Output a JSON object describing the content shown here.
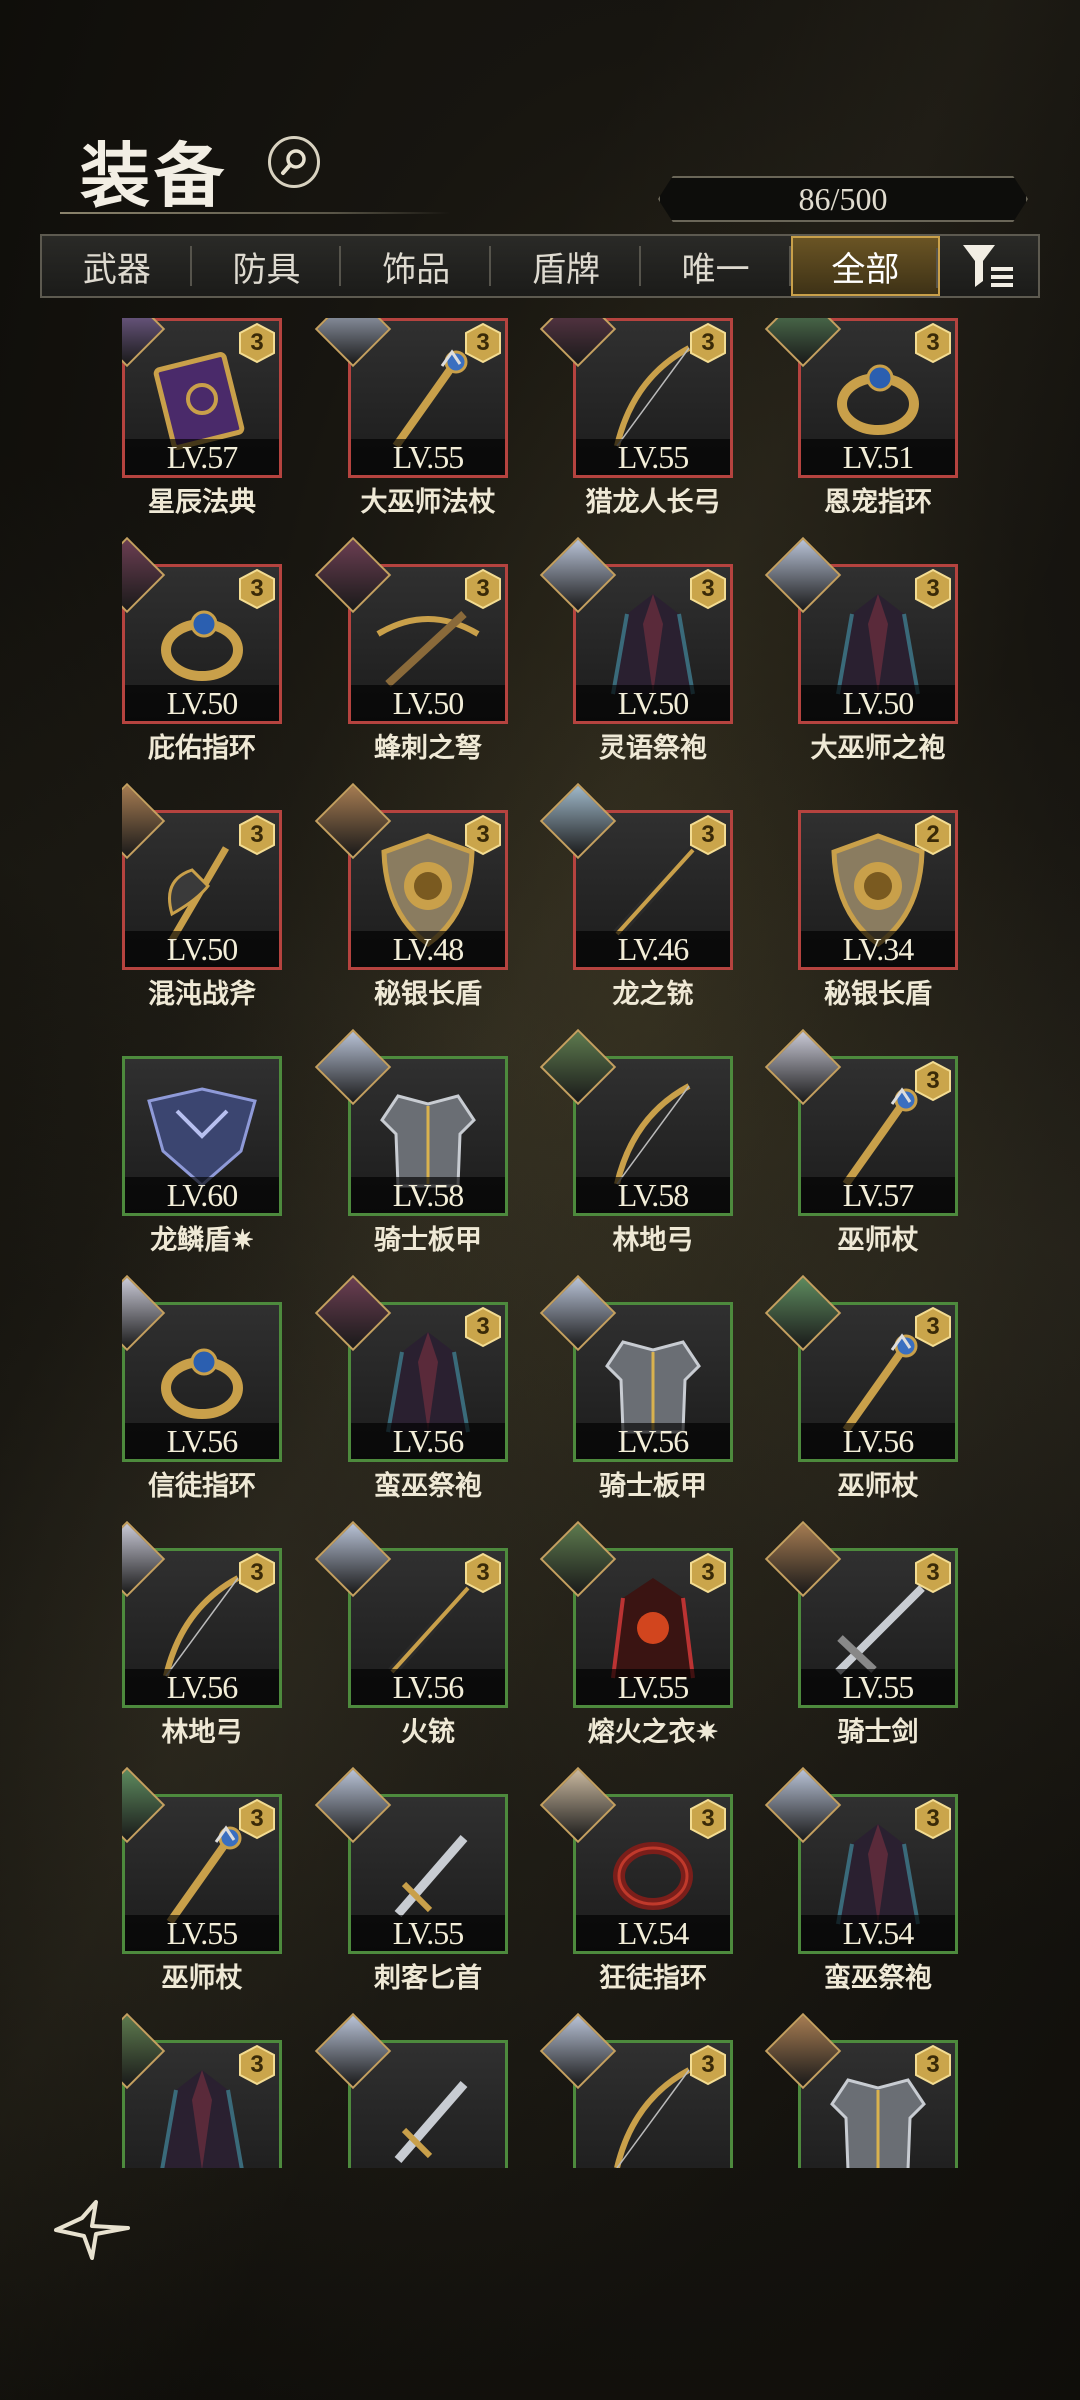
{
  "header": {
    "title": "装备"
  },
  "counter": {
    "text": "86/500"
  },
  "tabs": [
    {
      "label": "武器",
      "active": false
    },
    {
      "label": "防具",
      "active": false
    },
    {
      "label": "饰品",
      "active": false
    },
    {
      "label": "盾牌",
      "active": false
    },
    {
      "label": "唯一",
      "active": false
    },
    {
      "label": "全部",
      "active": true
    }
  ],
  "colors": {
    "red_border": "#b5433f",
    "green_border": "#4d8a3d",
    "gold": "#c9a04a"
  },
  "items": [
    {
      "name": "星辰法典",
      "level": "LV.57",
      "rank": "3",
      "rarity": "red",
      "icon": "book-icon",
      "portrait": "#8a6fa8"
    },
    {
      "name": "大巫师法杖",
      "level": "LV.55",
      "rank": "3",
      "rarity": "red",
      "icon": "staff-icon",
      "portrait": "#b8c2d6"
    },
    {
      "name": "猎龙人长弓",
      "level": "LV.55",
      "rank": "3",
      "rarity": "red",
      "icon": "bow-icon",
      "portrait": "#6b3e52"
    },
    {
      "name": "恩宠指环",
      "level": "LV.51",
      "rank": "3",
      "rarity": "red",
      "icon": "ring-icon",
      "portrait": "#5d8a5e"
    },
    {
      "name": "庇佑指环",
      "level": "LV.50",
      "rank": "3",
      "rarity": "red",
      "icon": "ring-icon",
      "portrait": "#6b3e52"
    },
    {
      "name": "蜂刺之弩",
      "level": "LV.50",
      "rank": "3",
      "rarity": "red",
      "icon": "crossbow-icon",
      "portrait": "#6b3e52"
    },
    {
      "name": "灵语祭袍",
      "level": "LV.50",
      "rank": "3",
      "rarity": "red",
      "icon": "robe-icon",
      "portrait": "#b8c2d6"
    },
    {
      "name": "大巫师之袍",
      "level": "LV.50",
      "rank": "3",
      "rarity": "red",
      "icon": "robe-icon",
      "portrait": "#b8c2d6"
    },
    {
      "name": "混沌战斧",
      "level": "LV.50",
      "rank": "3",
      "rarity": "red",
      "icon": "axe-icon",
      "portrait": "#a67c52"
    },
    {
      "name": "秘银长盾",
      "level": "LV.48",
      "rank": "3",
      "rarity": "red",
      "icon": "shield-icon",
      "portrait": "#a67c52"
    },
    {
      "name": "龙之铳",
      "level": "LV.46",
      "rank": "3",
      "rarity": "red",
      "icon": "gun-icon",
      "portrait": "#9fb8c9"
    },
    {
      "name": "秘银长盾",
      "level": "LV.34",
      "rank": "2",
      "rarity": "red",
      "icon": "shield-icon",
      "portrait": ""
    },
    {
      "name": "龙鳞盾",
      "level": "LV.60",
      "rank": "",
      "rarity": "green",
      "icon": "dragon-shield-icon",
      "portrait": "",
      "star": "✷"
    },
    {
      "name": "骑士板甲",
      "level": "LV.58",
      "rank": "",
      "rarity": "green",
      "icon": "armor-icon",
      "portrait": "#b8c2d6"
    },
    {
      "name": "林地弓",
      "level": "LV.58",
      "rank": "",
      "rarity": "green",
      "icon": "bow-icon",
      "portrait": "#5d7a4e"
    },
    {
      "name": "巫师杖",
      "level": "LV.57",
      "rank": "3",
      "rarity": "green",
      "icon": "staff-icon",
      "portrait": "#c9c9d6"
    },
    {
      "name": "信徒指环",
      "level": "LV.56",
      "rank": "",
      "rarity": "green",
      "icon": "ring-icon",
      "portrait": "#c9c9d6"
    },
    {
      "name": "蛮巫祭袍",
      "level": "LV.56",
      "rank": "3",
      "rarity": "green",
      "icon": "robe-icon",
      "portrait": "#6b3e52"
    },
    {
      "name": "骑士板甲",
      "level": "LV.56",
      "rank": "",
      "rarity": "green",
      "icon": "armor-icon",
      "portrait": "#b8c2d6"
    },
    {
      "name": "巫师杖",
      "level": "LV.56",
      "rank": "3",
      "rarity": "green",
      "icon": "staff-icon",
      "portrait": "#5d8a5e"
    },
    {
      "name": "林地弓",
      "level": "LV.56",
      "rank": "3",
      "rarity": "green",
      "icon": "bow-icon",
      "portrait": "#c9c9d6"
    },
    {
      "name": "火铳",
      "level": "LV.56",
      "rank": "3",
      "rarity": "green",
      "icon": "gun-icon",
      "portrait": "#b8c2d6"
    },
    {
      "name": "熔火之衣",
      "level": "LV.55",
      "rank": "3",
      "rarity": "green",
      "icon": "fire-robe-icon",
      "portrait": "#5d7a4e",
      "star": "✷"
    },
    {
      "name": "骑士剑",
      "level": "LV.55",
      "rank": "3",
      "rarity": "green",
      "icon": "sword-icon",
      "portrait": "#a67c52"
    },
    {
      "name": "巫师杖",
      "level": "LV.55",
      "rank": "3",
      "rarity": "green",
      "icon": "staff-icon",
      "portrait": "#5d8a5e"
    },
    {
      "name": "刺客匕首",
      "level": "LV.55",
      "rank": "",
      "rarity": "green",
      "icon": "dagger-icon",
      "portrait": "#b8c2d6"
    },
    {
      "name": "狂徒指环",
      "level": "LV.54",
      "rank": "3",
      "rarity": "green",
      "icon": "red-ring-icon",
      "portrait": "#c9b89f"
    },
    {
      "name": "蛮巫祭袍",
      "level": "LV.54",
      "rank": "3",
      "rarity": "green",
      "icon": "robe-icon",
      "portrait": "#b8c2d6"
    },
    {
      "name": "",
      "level": "",
      "rank": "3",
      "rarity": "green",
      "icon": "robe-icon",
      "portrait": "#5d7a4e"
    },
    {
      "name": "",
      "level": "",
      "rank": "",
      "rarity": "green",
      "icon": "dagger-icon",
      "portrait": "#b8c2d6"
    },
    {
      "name": "",
      "level": "",
      "rank": "3",
      "rarity": "green",
      "icon": "bow-icon",
      "portrait": "#b8c2d6"
    },
    {
      "name": "",
      "level": "",
      "rank": "3",
      "rarity": "green",
      "icon": "armor-icon",
      "portrait": "#a67c52"
    }
  ]
}
